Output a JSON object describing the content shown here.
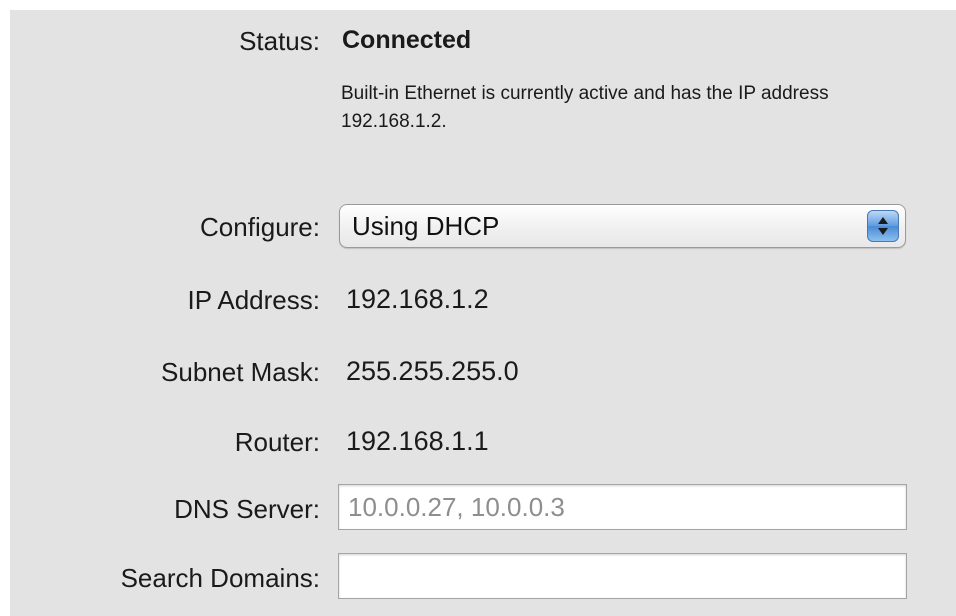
{
  "status": {
    "label": "Status:",
    "value": "Connected",
    "description": "Built-in Ethernet is currently active and has the IP address 192.168.1.2."
  },
  "configure": {
    "label": "Configure:",
    "selected": "Using DHCP"
  },
  "ip_address": {
    "label": "IP Address:",
    "value": "192.168.1.2"
  },
  "subnet_mask": {
    "label": "Subnet Mask:",
    "value": "255.255.255.0"
  },
  "router": {
    "label": "Router:",
    "value": "192.168.1.1"
  },
  "dns_server": {
    "label": "DNS Server:",
    "placeholder": "10.0.0.27, 10.0.0.3",
    "value": ""
  },
  "search_domains": {
    "label": "Search Domains:",
    "value": ""
  },
  "colors": {
    "panel_background": "#e3e3e3",
    "stepper_blue": "#5f9be0",
    "placeholder_gray": "#8e8e8e"
  },
  "icons": {
    "popup_stepper": "up-down-arrows-icon"
  }
}
